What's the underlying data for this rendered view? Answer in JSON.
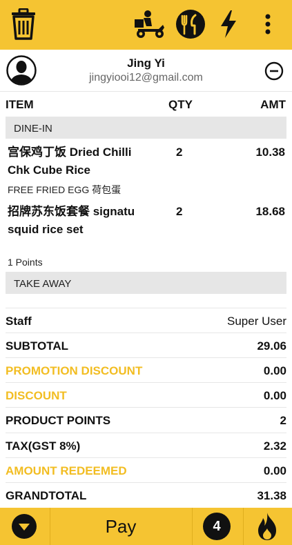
{
  "customer": {
    "name": "Jing Yi",
    "email": "jingyiooi12@gmail.com"
  },
  "table_header": {
    "item": "ITEM",
    "qty": "QTY",
    "amt": "AMT"
  },
  "sections": {
    "dine_in": "DINE-IN",
    "take_away": "TAKE AWAY"
  },
  "items": [
    {
      "name": "宫保鸡丁饭 Dried Chilli Chk Cube Rice",
      "qty": "2",
      "amt": "10.38",
      "note": "FREE FRIED EGG 荷包蛋"
    },
    {
      "name": "招牌苏东饭套餐 signatu squid rice set",
      "qty": "2",
      "amt": "18.68",
      "note": "1 Points"
    }
  ],
  "summary": {
    "staff_label": "Staff",
    "staff_value": "Super User",
    "subtotal_label": "SUBTOTAL",
    "subtotal_value": "29.06",
    "promo_label": "PROMOTION DISCOUNT",
    "promo_value": "0.00",
    "discount_label": "DISCOUNT",
    "discount_value": "0.00",
    "points_label": "PRODUCT POINTS",
    "points_value": "2",
    "tax_label": "TAX(GST 8%)",
    "tax_value": "2.32",
    "redeemed_label": "AMOUNT REDEEMED",
    "redeemed_value": "0.00",
    "grand_label": "GRANDTOTAL",
    "grand_value": "31.38"
  },
  "bottom": {
    "pay_label": "Pay",
    "item_count": "4"
  },
  "icons": {
    "top": [
      "trash-icon",
      "delivery-scooter-icon",
      "dine-in-cutlery-icon",
      "lightning-icon",
      "more-vertical-icon"
    ],
    "customer": [
      "avatar-icon",
      "remove-customer-icon"
    ],
    "bottom": [
      "chevron-down-icon",
      "fire-icon"
    ]
  },
  "colors": {
    "accent": "#f5c432",
    "highlight_text": "#f2bd22",
    "section_bg": "#e6e6e6"
  }
}
